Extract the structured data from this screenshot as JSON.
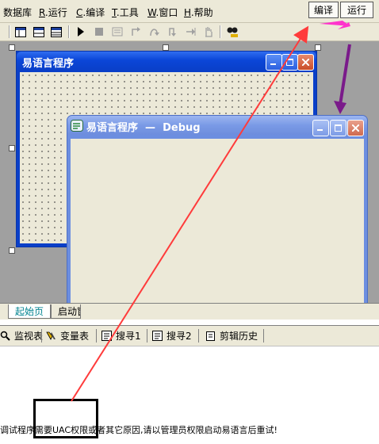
{
  "menubar": {
    "items": [
      {
        "label": "数据库"
      },
      {
        "key": "R",
        "label": ".运行"
      },
      {
        "key": "C",
        "label": ".编译"
      },
      {
        "key": "T",
        "label": ".工具"
      },
      {
        "key": "W",
        "label": ".窗口"
      },
      {
        "key": "H",
        "label": ".帮助"
      }
    ],
    "compile_button": "编译",
    "run_button": "运行"
  },
  "toolbar": {
    "icons": [
      "layout-1-icon",
      "layout-2-icon",
      "layout-3-icon",
      "play-icon",
      "stop-icon",
      "step-icon",
      "step-into-icon",
      "step-over-icon",
      "step-out-icon",
      "run-to-cursor-icon",
      "hand-icon",
      "find-icon"
    ]
  },
  "designer_window": {
    "title": "易语言程序"
  },
  "debug_window": {
    "title": "易语言程序  —  Debug"
  },
  "designer_tabs": {
    "start_page": "起始页",
    "second_tab": "启动窗口"
  },
  "bottom_tabs": [
    {
      "label": "监视表",
      "icon": "watch-icon"
    },
    {
      "label": "变量表",
      "icon": "variables-icon"
    },
    {
      "label": "搜寻1",
      "icon": "search1-icon"
    },
    {
      "label": "搜寻2",
      "icon": "search2-icon"
    },
    {
      "label": "剪辑历史",
      "icon": "clip-history-icon"
    }
  ],
  "status_message": "调试程序需要UAC权限或者其它原因,请以管理员权限启动易语言后重试!",
  "colors": {
    "annotation_red": "#ff3b3b",
    "annotation_pink": "#ff33cc",
    "annotation_purple": "#7a1a8a",
    "xp_blue": "#0a3fc8"
  }
}
